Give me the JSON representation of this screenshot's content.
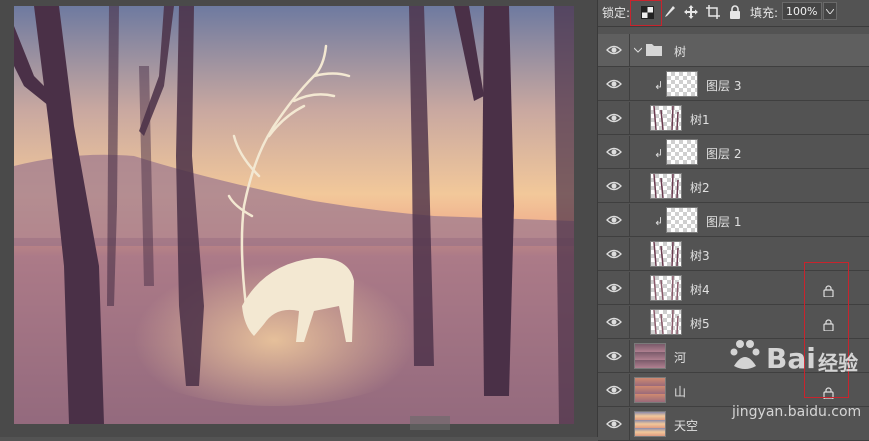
{
  "toolbar": {
    "lock_label": "锁定:",
    "fill_label": "填充:",
    "fill_value": "100%",
    "icons": [
      "lock-transparent-pixels-icon",
      "lock-image-pixels-icon",
      "lock-position-icon",
      "lock-artboard-icon",
      "lock-all-icon"
    ]
  },
  "layers": {
    "group_name": "树",
    "items": [
      {
        "name": "图层 3",
        "clipped": true,
        "locked": false
      },
      {
        "name": "树1",
        "clipped": false,
        "locked": false
      },
      {
        "name": "图层 2",
        "clipped": true,
        "locked": false
      },
      {
        "name": "树2",
        "clipped": false,
        "locked": false
      },
      {
        "name": "图层 1",
        "clipped": true,
        "locked": false
      },
      {
        "name": "树3",
        "clipped": false,
        "locked": false
      },
      {
        "name": "树4",
        "clipped": false,
        "locked": true
      },
      {
        "name": "树5",
        "clipped": false,
        "locked": true
      },
      {
        "name": "河",
        "clipped": false,
        "locked": false
      },
      {
        "name": "山",
        "clipped": false,
        "locked": true
      },
      {
        "name": "天空",
        "clipped": false,
        "locked": false
      }
    ]
  },
  "watermark": {
    "brand": "Bai",
    "brand_suffix": "经验",
    "url": "jingyan.baidu.com"
  },
  "colors": {
    "highlight": "#c8242d",
    "panel_bg": "#535353"
  }
}
